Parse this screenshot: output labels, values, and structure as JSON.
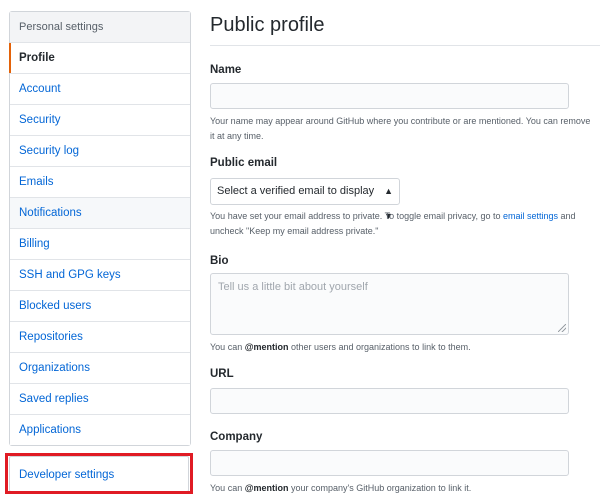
{
  "sidebar": {
    "header": "Personal settings",
    "items": [
      {
        "label": "Profile"
      },
      {
        "label": "Account"
      },
      {
        "label": "Security"
      },
      {
        "label": "Security log"
      },
      {
        "label": "Emails"
      },
      {
        "label": "Notifications"
      },
      {
        "label": "Billing"
      },
      {
        "label": "SSH and GPG keys"
      },
      {
        "label": "Blocked users"
      },
      {
        "label": "Repositories"
      },
      {
        "label": "Organizations"
      },
      {
        "label": "Saved replies"
      },
      {
        "label": "Applications"
      }
    ],
    "developer_settings": "Developer settings"
  },
  "main": {
    "title": "Public profile",
    "name": {
      "label": "Name",
      "value": "",
      "note": "Your name may appear around GitHub where you contribute or are mentioned. You can remove it at any time."
    },
    "public_email": {
      "label": "Public email",
      "selected": "Select a verified email to display",
      "note_before": "You have set your email address to private. To toggle email privacy, go to ",
      "note_link": "email settings",
      "note_after": " and uncheck \"Keep my email address private.\""
    },
    "bio": {
      "label": "Bio",
      "placeholder": "Tell us a little bit about yourself",
      "note_before": "You can ",
      "note_mention": "@mention",
      "note_after": " other users and organizations to link to them."
    },
    "url": {
      "label": "URL",
      "value": ""
    },
    "company": {
      "label": "Company",
      "value": "",
      "note_before": "You can ",
      "note_mention": "@mention",
      "note_after": " your company's GitHub organization to link it."
    }
  },
  "colors": {
    "link": "#0366d6",
    "selected_accent": "#e36209",
    "highlight_box": "#e01b24"
  }
}
